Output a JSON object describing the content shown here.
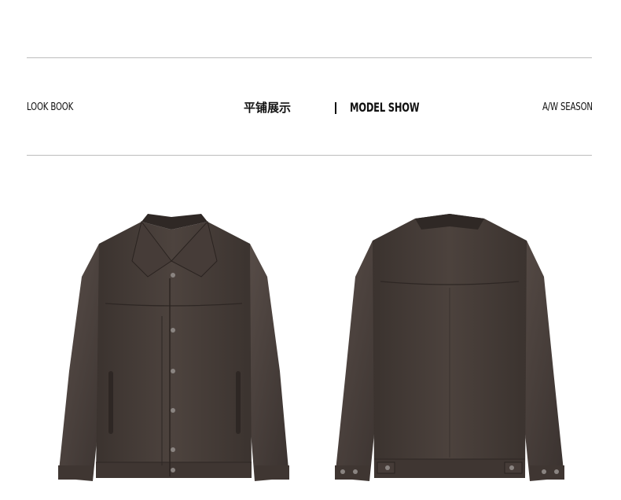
{
  "header": {
    "left_label": "LOOK BOOK",
    "center_cn": "平铺展示",
    "center_en": "MODEL SHOW",
    "right_label": "A/W SEASON"
  },
  "colors": {
    "leather": "#4a403c",
    "leather_dark": "#3a322f",
    "leather_light": "#5a4f4a",
    "rule": "#bdbdbd",
    "text": "#111111"
  },
  "images": [
    {
      "name": "jacket-front",
      "description_icon": "leather-jacket-front-icon"
    },
    {
      "name": "jacket-back",
      "description_icon": "leather-jacket-back-icon"
    }
  ]
}
